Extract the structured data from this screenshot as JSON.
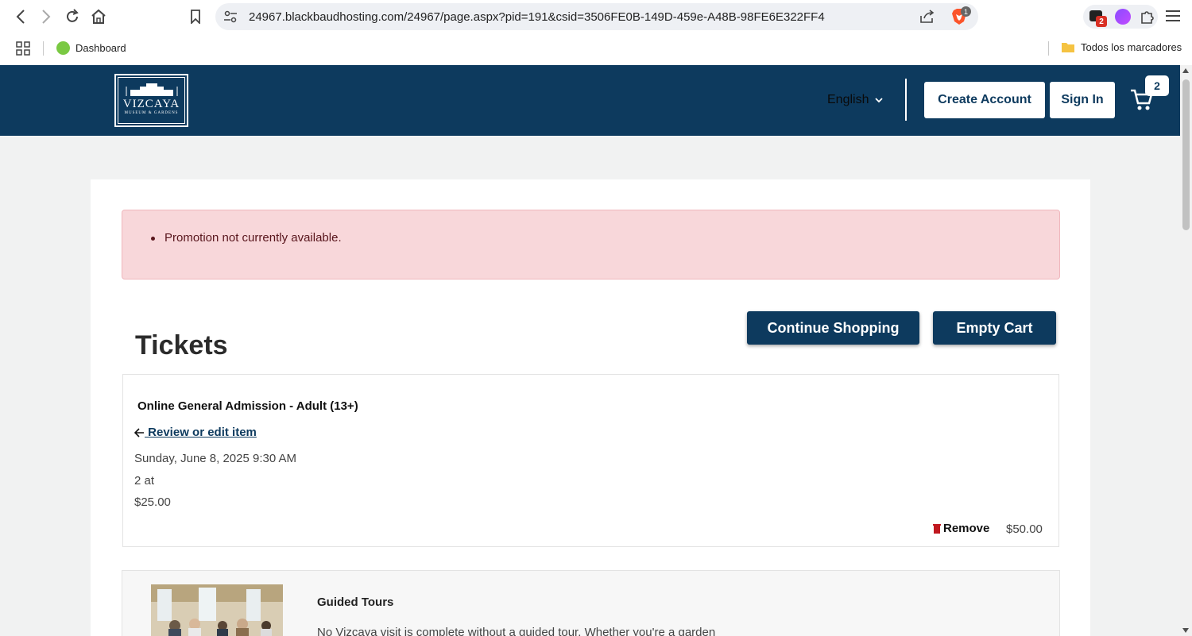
{
  "browser": {
    "url": "24967.blackbaudhosting.com/24967/page.aspx?pid=191&csid=3506FE0B-149D-459e-A48B-98FE6E322FF4",
    "brave_badge": "1",
    "ext_badge": "2",
    "bookmarks": {
      "dashboard": "Dashboard",
      "all_bookmarks": "Todos los marcadores"
    }
  },
  "header": {
    "logo_title": "VIZCAYA",
    "logo_subtitle": "MUSEUM & GARDENS",
    "language": "English",
    "create_account": "Create Account",
    "sign_in": "Sign In",
    "cart_count": "2",
    "brand_color": "#0d3a5e"
  },
  "alert": {
    "message": "Promotion not currently available."
  },
  "cart": {
    "title": "Tickets",
    "continue_shopping": "Continue Shopping",
    "empty_cart": "Empty Cart",
    "item": {
      "name": "Online General Admission - Adult (13+)",
      "review_link": " Review or edit item",
      "date": "Sunday, June 8, 2025 9:30 AM",
      "quantity": "2 at",
      "unit_price": "$25.00",
      "remove": "Remove",
      "total": "$50.00"
    }
  },
  "upsell": {
    "title": "Guided Tours",
    "description": "No Vizcaya visit is complete without a guided tour. Whether you're a garden"
  }
}
